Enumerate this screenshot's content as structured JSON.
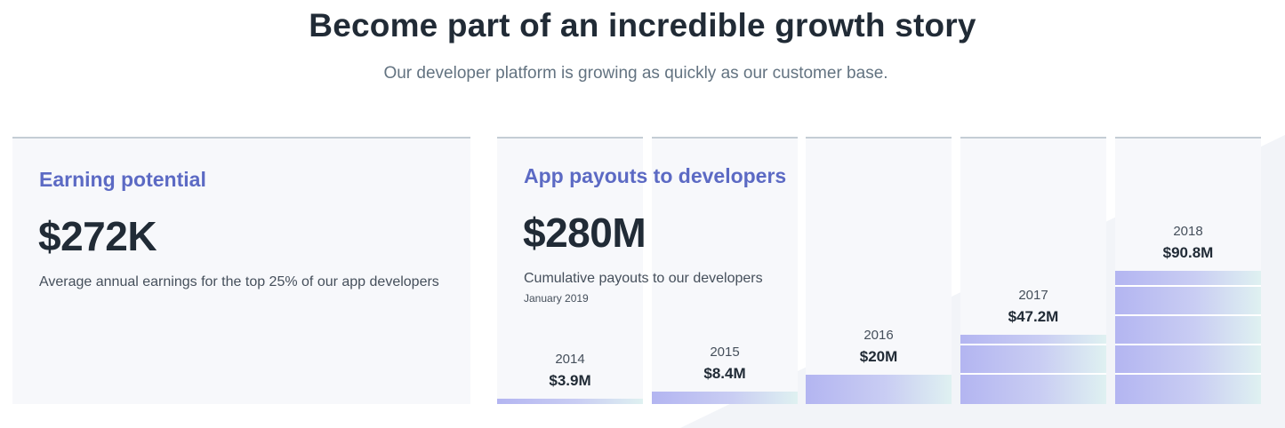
{
  "header": {
    "title": "Become part of an incredible growth story",
    "subtitle": "Our developer platform is growing as quickly as our customer base."
  },
  "earning": {
    "title": "Earning potential",
    "value": "$272K",
    "description": "Average annual earnings for the top 25% of our app developers"
  },
  "payouts": {
    "title": "App payouts to developers",
    "value": "$280M",
    "description": "Cumulative payouts to our developers",
    "date": "January 2019"
  },
  "chart_data": {
    "type": "bar",
    "categories": [
      "2014",
      "2015",
      "2016",
      "2017",
      "2018"
    ],
    "values": [
      3.9,
      8.4,
      20,
      47.2,
      90.8
    ],
    "value_labels": [
      "$3.9M",
      "$8.4M",
      "$20M",
      "$47.2M",
      "$90.8M"
    ],
    "ylabel": "",
    "unit": "$M"
  },
  "colors": {
    "accent": "#5c6ac4",
    "text": "#212b36",
    "muted": "#637381",
    "card_bg": "#f7f8fb"
  }
}
